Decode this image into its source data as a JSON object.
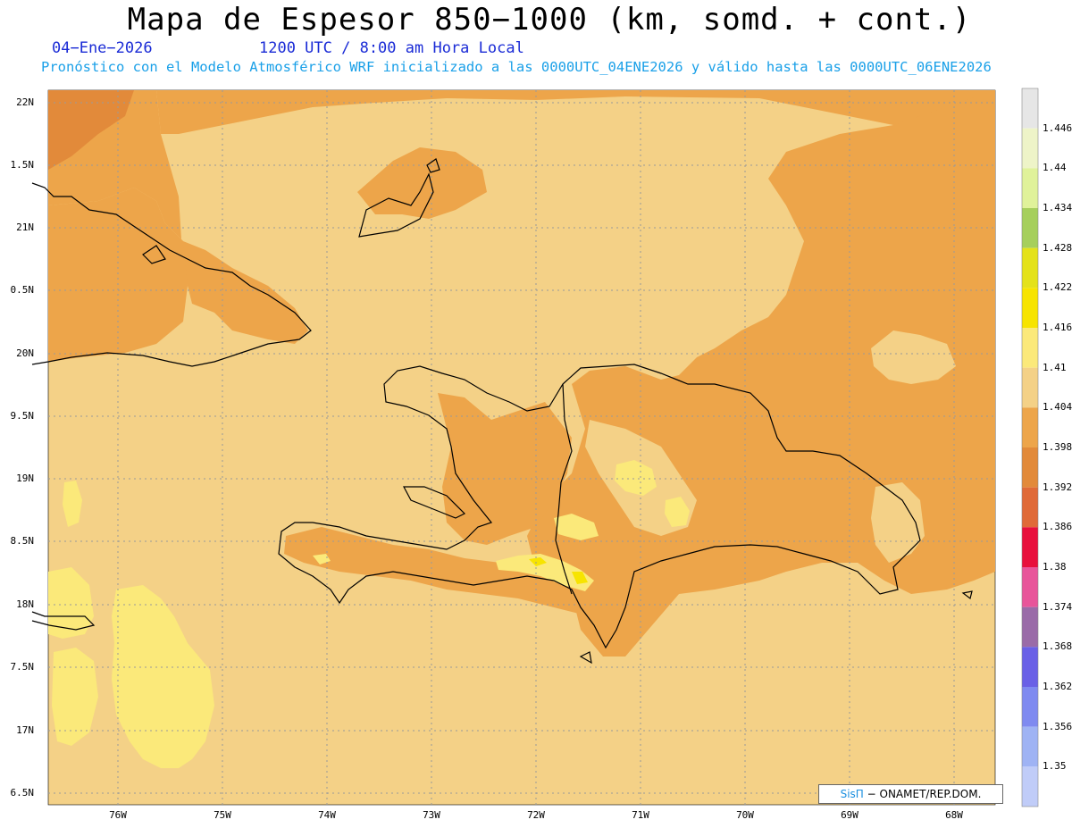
{
  "header": {
    "title": "Mapa de Espesor 850−1000 (km, somd. + cont.)",
    "date": "04−Ene−2026",
    "time": "1200 UTC / 8:00 am Hora Local",
    "description": "Pronóstico con el Modelo Atmosférico WRF inicializado a las 0000UTC_04ENE2026 y válido hasta las  0000UTC_06ENE2026"
  },
  "axes": {
    "lat_labels": [
      "22N",
      "1.5N",
      "21N",
      "0.5N",
      "20N",
      "9.5N",
      "19N",
      "8.5N",
      "18N",
      "7.5N",
      "17N",
      "6.5N"
    ],
    "lon_labels": [
      "76W",
      "75W",
      "74W",
      "73W",
      "72W",
      "71W",
      "70W",
      "69W",
      "68W"
    ]
  },
  "colorbar": {
    "labels": [
      "1.446",
      "1.44",
      "1.434",
      "1.428",
      "1.422",
      "1.416",
      "1.41",
      "1.404",
      "1.398",
      "1.392",
      "1.386",
      "1.38",
      "1.374",
      "1.368",
      "1.362",
      "1.356",
      "1.35"
    ],
    "colors": [
      "#e6e6e6",
      "#eef4c8",
      "#e0f29a",
      "#a6cf5c",
      "#e4e21a",
      "#f7e400",
      "#fbe97a",
      "#f4d187",
      "#eda54a",
      "#e28a3a",
      "#e06a38",
      "#e8103c",
      "#e8559a",
      "#9a6ba8",
      "#6a60e6",
      "#7f8af0",
      "#9fb3f4",
      "#c0ccf8"
    ]
  },
  "map": {
    "colors": {
      "fill_1404": "#f4d187",
      "fill_1398": "#eda54a",
      "fill_1392": "#e28a3a",
      "fill_1410": "#fbe97a",
      "fill_1416": "#f7e400",
      "coast": "#000000",
      "grid": "#999999"
    }
  },
  "credit": {
    "brand": "SisΠ",
    "text": " − ONAMET/REP.DOM."
  }
}
